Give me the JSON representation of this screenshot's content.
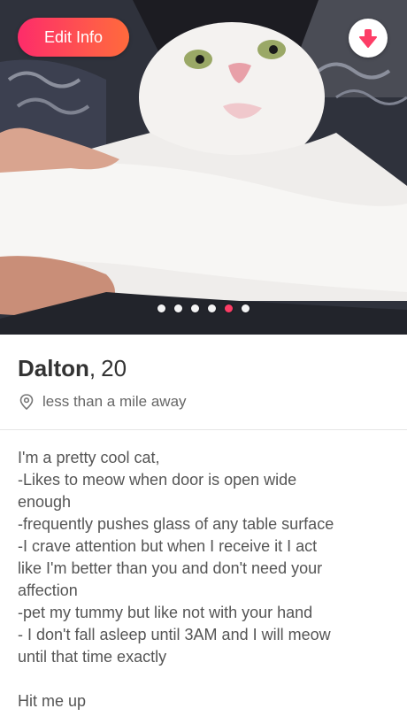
{
  "header": {
    "edit_label": "Edit Info",
    "down_icon": "arrow-down-icon"
  },
  "photo": {
    "dot_count": 6,
    "active_index": 4
  },
  "profile": {
    "name": "Dalton",
    "separator": ",",
    "age": "20",
    "location": "less than a mile away",
    "location_icon": "map-pin-icon"
  },
  "bio": {
    "lines": [
      "I'm a pretty cool cat,",
      "-Likes to meow when door is open wide",
      "enough",
      "-frequently pushes glass of any table surface",
      "-I crave attention but when I receive it I act",
      "like I'm better than you and don't need your",
      "affection",
      "-pet my tummy but like not with your hand",
      "- I don't fall asleep until 3AM and I will meow",
      "until that time exactly"
    ],
    "closing": "Hit me up"
  },
  "colors": {
    "accent": "#fd3d66",
    "button_gradient_start": "#fd2c6a",
    "button_gradient_end": "#ff6a3c"
  }
}
